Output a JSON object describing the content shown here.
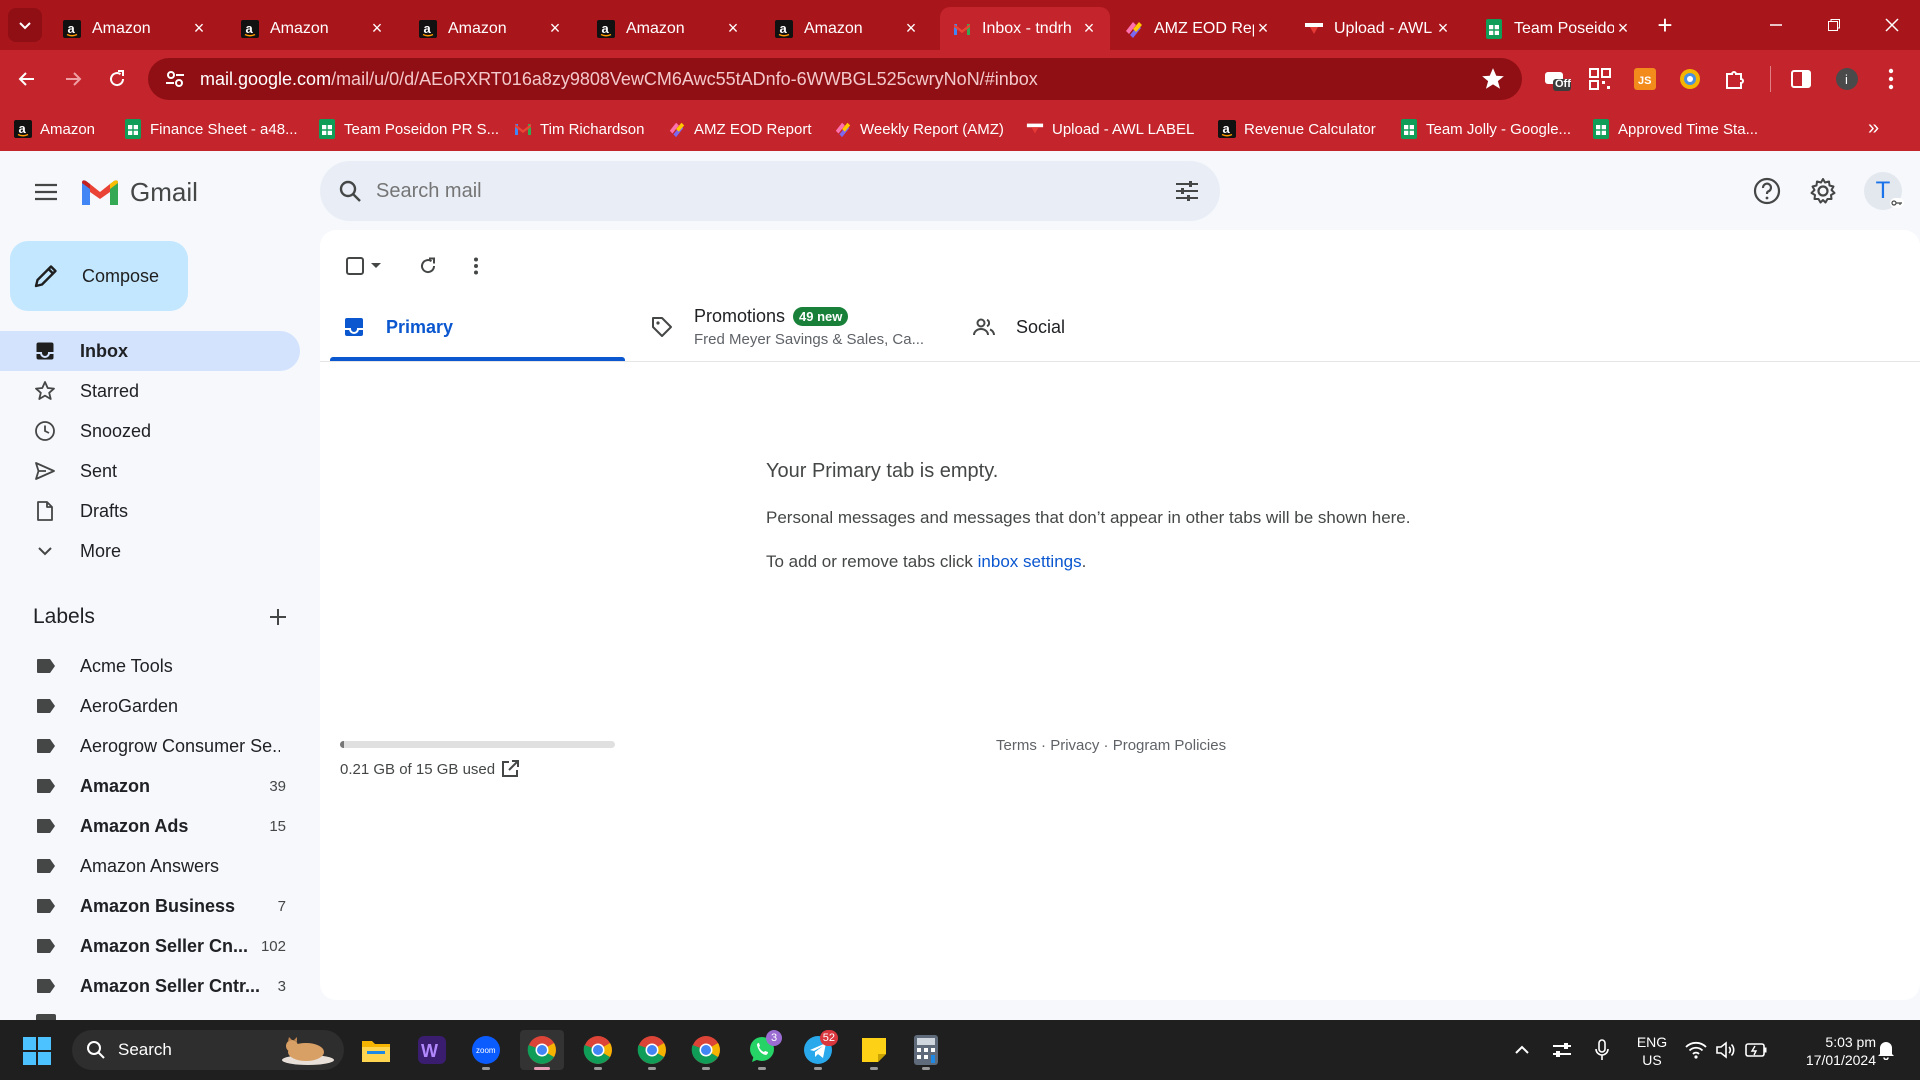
{
  "browser": {
    "tabs": [
      {
        "title": "Amazon",
        "favicon": "amazon-icon"
      },
      {
        "title": "Amazon",
        "favicon": "amazon-icon"
      },
      {
        "title": "Amazon",
        "favicon": "amazon-icon"
      },
      {
        "title": "Amazon",
        "favicon": "amazon-icon"
      },
      {
        "title": "Amazon",
        "favicon": "amazon-icon"
      },
      {
        "title": "Inbox - tndrh",
        "favicon": "gmail-icon",
        "active": true
      },
      {
        "title": "AMZ EOD Rep",
        "favicon": "clickup-icon"
      },
      {
        "title": "Upload - AWL",
        "favicon": "awl-icon"
      },
      {
        "title": "Team Poseido",
        "favicon": "sheets-icon"
      }
    ],
    "url_host": "mail.google.com",
    "url_path": "/mail/u/0/d/AEoRXRT016a8zy9808VewCM6Awc55tADnfo-6WWBGL525cwryNoN/#inbox",
    "bookmarks": [
      {
        "label": "Amazon",
        "icon": "amazon-icon"
      },
      {
        "label": "Finance Sheet - a48...",
        "icon": "sheets-icon"
      },
      {
        "label": "Team Poseidon PR S...",
        "icon": "sheets-icon"
      },
      {
        "label": "Tim Richardson",
        "icon": "gmail-icon"
      },
      {
        "label": "AMZ EOD Report",
        "icon": "clickup-icon"
      },
      {
        "label": "Weekly Report (AMZ)",
        "icon": "clickup-icon"
      },
      {
        "label": "Upload - AWL LABEL",
        "icon": "awl-icon"
      },
      {
        "label": "Revenue Calculator",
        "icon": "amazon-icon"
      },
      {
        "label": "Team Jolly - Google...",
        "icon": "sheets-icon"
      },
      {
        "label": "Approved Time Sta...",
        "icon": "sheets-icon"
      }
    ],
    "ext_off_label": "Off",
    "colors": {
      "chrome": "#a8151b",
      "toolbar": "#c4242b"
    }
  },
  "gmail": {
    "product_name": "Gmail",
    "search_placeholder": "Search mail",
    "avatar_initial": "T",
    "compose_label": "Compose",
    "nav": [
      {
        "label": "Inbox",
        "icon": "inbox-icon",
        "active": true
      },
      {
        "label": "Starred",
        "icon": "star-icon"
      },
      {
        "label": "Snoozed",
        "icon": "clock-icon"
      },
      {
        "label": "Sent",
        "icon": "send-icon"
      },
      {
        "label": "Drafts",
        "icon": "draft-icon"
      },
      {
        "label": "More",
        "icon": "chevron-down-icon"
      }
    ],
    "labels_header": "Labels",
    "labels": [
      {
        "name": "Acme Tools",
        "count": "",
        "bold": false
      },
      {
        "name": "AeroGarden",
        "count": "",
        "bold": false
      },
      {
        "name": "Aerogrow Consumer Se...",
        "count": "",
        "bold": false
      },
      {
        "name": "Amazon",
        "count": "39",
        "bold": true
      },
      {
        "name": "Amazon Ads",
        "count": "15",
        "bold": true
      },
      {
        "name": "Amazon Answers",
        "count": "",
        "bold": false
      },
      {
        "name": "Amazon Business",
        "count": "7",
        "bold": true
      },
      {
        "name": "Amazon Seller Cn...",
        "count": "102",
        "bold": true
      },
      {
        "name": "Amazon Seller Cntr...",
        "count": "3",
        "bold": true
      }
    ],
    "category_tabs": {
      "primary": "Primary",
      "promotions": "Promotions",
      "promotions_badge": "49 new",
      "promotions_snippet": "Fred Meyer Savings & Sales, Ca...",
      "social": "Social"
    },
    "empty_state": {
      "title": "Your Primary tab is empty.",
      "line1": "Personal messages and messages that don’t appear in other tabs will be shown here.",
      "line2_prefix": "To add or remove tabs click ",
      "line2_link": "inbox settings",
      "line2_suffix": "."
    },
    "storage": {
      "text": "0.21 GB of 15 GB used",
      "used_fraction": 0.014
    },
    "footer": {
      "terms": "Terms",
      "privacy": "Privacy",
      "policies": "Program Policies",
      "sep": " · "
    }
  },
  "taskbar": {
    "search_label": "Search",
    "apps": [
      {
        "name": "file-explorer-icon"
      },
      {
        "name": "wordtune-icon"
      },
      {
        "name": "zoom-icon",
        "text": "zoom"
      },
      {
        "name": "chrome-icon",
        "active": true
      },
      {
        "name": "chrome-icon"
      },
      {
        "name": "chrome-icon"
      },
      {
        "name": "chrome-icon"
      },
      {
        "name": "whatsapp-icon",
        "badge": "3"
      },
      {
        "name": "telegram-icon",
        "badge": "52"
      },
      {
        "name": "sticky-notes-icon"
      },
      {
        "name": "calculator-icon"
      }
    ],
    "lang_line1": "ENG",
    "lang_line2": "US",
    "time": "5:03 pm",
    "date": "17/01/2024"
  }
}
